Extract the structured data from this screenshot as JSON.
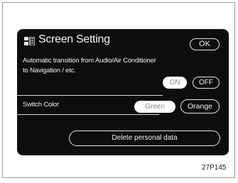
{
  "screen": {
    "title": "Screen Setting",
    "title_icon": "screen-setting-icon",
    "ok_label": "OK"
  },
  "transition": {
    "line1": "Automatic transition from Audio/Air Conditioner",
    "line2": "to Navigation / etc.",
    "on_label": "ON",
    "off_label": "OFF",
    "selected": "ON"
  },
  "switch_color": {
    "label": "Switch Color",
    "green_label": "Green",
    "orange_label": "Orange",
    "selected": "Green"
  },
  "delete_label": "Delete personal data",
  "figure_code": "27P145",
  "colors": {
    "screen_bg": "#0d0d0d",
    "text": "#f2f2f2",
    "selected_button_bg": "#ffffff",
    "selected_button_text": "#8a8a8a"
  }
}
